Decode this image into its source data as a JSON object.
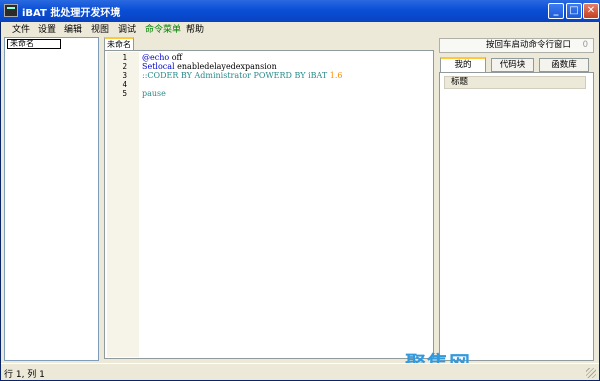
{
  "window": {
    "title": "iBAT 批处理开发环境",
    "controls": {
      "minimize": "_",
      "maximize": "□",
      "close": "✕"
    }
  },
  "menu": [
    "文件",
    "设置",
    "编辑",
    "视图",
    "调试",
    "命令菜单",
    "帮助"
  ],
  "left_pane": {
    "field_value": "未命名"
  },
  "editor": {
    "tab_label": "未命名",
    "line_numbers": [
      "1",
      "2",
      "3",
      "4",
      "5"
    ],
    "lines": [
      {
        "parts": [
          "@echo",
          " off"
        ]
      },
      {
        "parts": [
          "Setlocal",
          " enabledelayedexpansion"
        ]
      },
      {
        "parts": [
          "::CODER BY Administrator POWERD BY iBAT ",
          "1.6"
        ]
      },
      {
        "parts": []
      },
      {
        "parts": [
          "pause"
        ]
      }
    ]
  },
  "right_pane": {
    "button_label": "按回车启动命令行窗口",
    "button_count": "0",
    "tabs": [
      "我的",
      "代码块",
      "函数库"
    ],
    "list_header": "标题"
  },
  "status": {
    "text": "行 1, 列 1"
  },
  "watermark": "聚集网",
  "colors": {
    "title_bar": "#0a4fd6",
    "keyword": "#0000cc",
    "comment": "#2a8a8a",
    "number": "#ff8c00",
    "tab_accent": "#ffc83c"
  }
}
